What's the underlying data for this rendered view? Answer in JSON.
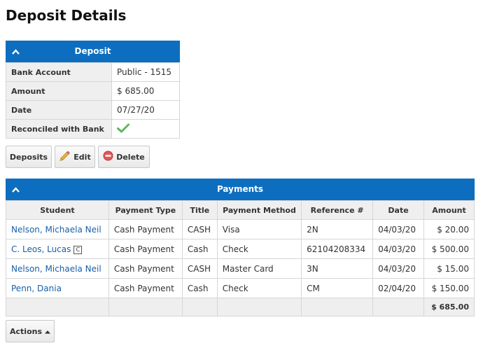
{
  "page": {
    "title": "Deposit Details"
  },
  "deposit": {
    "header": "Deposit",
    "rows": [
      {
        "label": "Bank Account",
        "value": "Public - 1515"
      },
      {
        "label": "Amount",
        "value": "$ 685.00"
      },
      {
        "label": "Date",
        "value": "07/27/20"
      },
      {
        "label": "Reconciled with Bank",
        "value": ""
      }
    ],
    "reconciled_icon": "checkmark-icon",
    "check_color": "#5cb85c"
  },
  "buttons": {
    "deposits": "Deposits",
    "edit": "Edit",
    "delete": "Delete",
    "actions": "Actions"
  },
  "payments": {
    "header": "Payments",
    "columns": [
      "Student",
      "Payment Type",
      "Title",
      "Payment Method",
      "Reference #",
      "Date",
      "Amount"
    ],
    "rows": [
      {
        "student": "Nelson, Michaela Neil",
        "badge": "",
        "type": "Cash Payment",
        "title": "CASH",
        "method": "Visa",
        "reference": "2N",
        "date": "04/03/20",
        "amount": "$ 20.00"
      },
      {
        "student": "C. Leos, Lucas",
        "badge": "C",
        "type": "Cash Payment",
        "title": "Cash",
        "method": "Check",
        "reference": "62104208334",
        "date": "04/03/20",
        "amount": "$ 500.00"
      },
      {
        "student": "Nelson, Michaela Neil",
        "badge": "",
        "type": "Cash Payment",
        "title": "CASH",
        "method": "Master Card",
        "reference": "3N",
        "date": "04/03/20",
        "amount": "$ 15.00"
      },
      {
        "student": "Penn, Dania",
        "badge": "",
        "type": "Cash Payment",
        "title": "Cash",
        "method": "Check",
        "reference": "CM",
        "date": "02/04/20",
        "amount": "$ 150.00"
      }
    ],
    "total": "$ 685.00"
  },
  "colors": {
    "header_blue": "#0d6ebf",
    "link_blue": "#1a5fa8"
  }
}
